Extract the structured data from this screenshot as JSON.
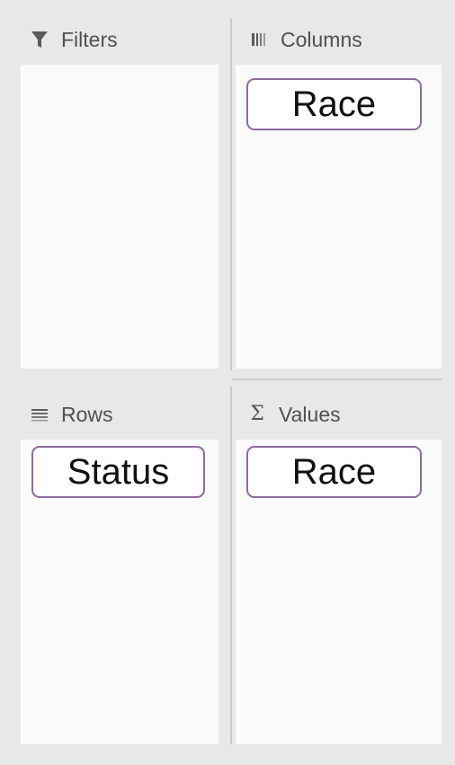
{
  "filters": {
    "label": "Filters",
    "icon": "filter-icon",
    "fields": []
  },
  "columns": {
    "label": "Columns",
    "icon": "columns-icon",
    "fields": [
      "Race"
    ]
  },
  "rows": {
    "label": "Rows",
    "icon": "rows-icon",
    "fields": [
      "Status"
    ]
  },
  "values": {
    "label": "Values",
    "icon": "sigma-icon",
    "icon_glyph": "Σ",
    "fields": [
      "Race"
    ]
  },
  "colors": {
    "background": "#e8e8e8",
    "zone": "#fafafa",
    "chip_border": "#8e6a9c",
    "header_text": "#505050"
  }
}
